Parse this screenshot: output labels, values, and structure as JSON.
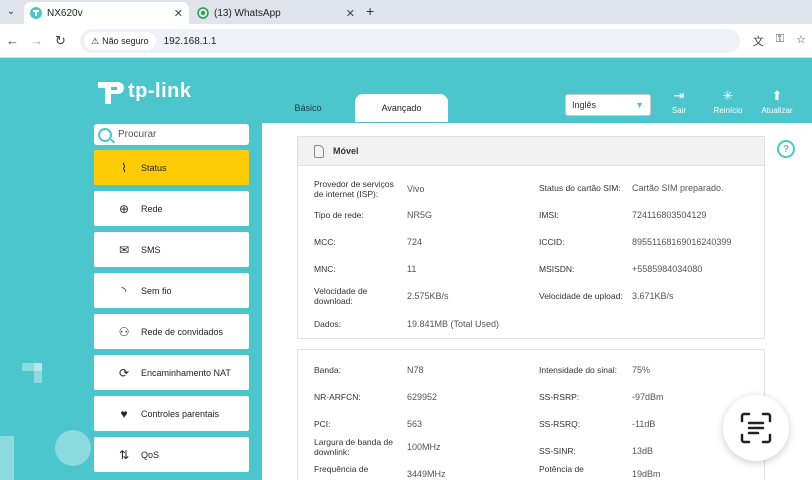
{
  "browser": {
    "tabs": [
      {
        "label": "NX620v",
        "active": true
      },
      {
        "label": "(13) WhatsApp",
        "active": false
      }
    ],
    "security_label": "Não seguro",
    "url": "192.168.1.1"
  },
  "app": {
    "logo_text": "tp-link",
    "tabs": {
      "basic": "Básico",
      "advanced": "Avançado"
    },
    "language": "Inglês",
    "actions": {
      "logout": "Sair",
      "reboot": "Reinício",
      "update": "Atualizar"
    },
    "search_placeholder": "Procurar"
  },
  "sidebar": {
    "items": [
      {
        "label": "Status",
        "icon": "pulse-icon",
        "active": true
      },
      {
        "label": "Rede",
        "icon": "globe-icon"
      },
      {
        "label": "SMS",
        "icon": "envelope-icon"
      },
      {
        "label": "Sem fio",
        "icon": "wifi-icon"
      },
      {
        "label": "Rede de convidados",
        "icon": "guests-icon"
      },
      {
        "label": "Encaminhamento NAT",
        "icon": "nat-icon"
      },
      {
        "label": "Controles parentais",
        "icon": "heart-icon"
      },
      {
        "label": "QoS",
        "icon": "qos-icon"
      }
    ]
  },
  "mobile": {
    "title": "Móvel",
    "left": [
      {
        "label": "Provedor de serviços de internet (ISP):",
        "value": "Vivo"
      },
      {
        "label": "Tipo de rede:",
        "value": "NR5G"
      },
      {
        "label": "MCC:",
        "value": "724"
      },
      {
        "label": "MNC:",
        "value": "11"
      },
      {
        "label": "Velocidade de download:",
        "value": "2.575KB/s"
      },
      {
        "label": "Dados:",
        "value": "19.841MB (Total Used)"
      }
    ],
    "right": [
      {
        "label": "Status do cartão SIM:",
        "value": "Cartão SIM preparado."
      },
      {
        "label": "IMSI:",
        "value": "724116803504129"
      },
      {
        "label": "ICCID:",
        "value": "89551168169016240399"
      },
      {
        "label": "MSISDN:",
        "value": "+5585984034080"
      },
      {
        "label": "Velocidade de upload:",
        "value": "3.671KB/s"
      }
    ]
  },
  "signal": {
    "left": [
      {
        "label": "Banda:",
        "value": "N78"
      },
      {
        "label": "NR-ARFCN:",
        "value": "629952"
      },
      {
        "label": "PCI:",
        "value": "563"
      },
      {
        "label": "Largura de banda de downlink:",
        "value": "100MHz"
      },
      {
        "label": "Frequência de",
        "value": "3449MHz"
      }
    ],
    "right": [
      {
        "label": "Intensidade do sinal:",
        "value": "75%"
      },
      {
        "label": "SS-RSRP:",
        "value": "-97dBm"
      },
      {
        "label": "SS-RSRQ:",
        "value": "-11dB"
      },
      {
        "label": "SS-SINR:",
        "value": "13dB"
      },
      {
        "label": "Potência de",
        "value": "19dBm"
      }
    ]
  }
}
